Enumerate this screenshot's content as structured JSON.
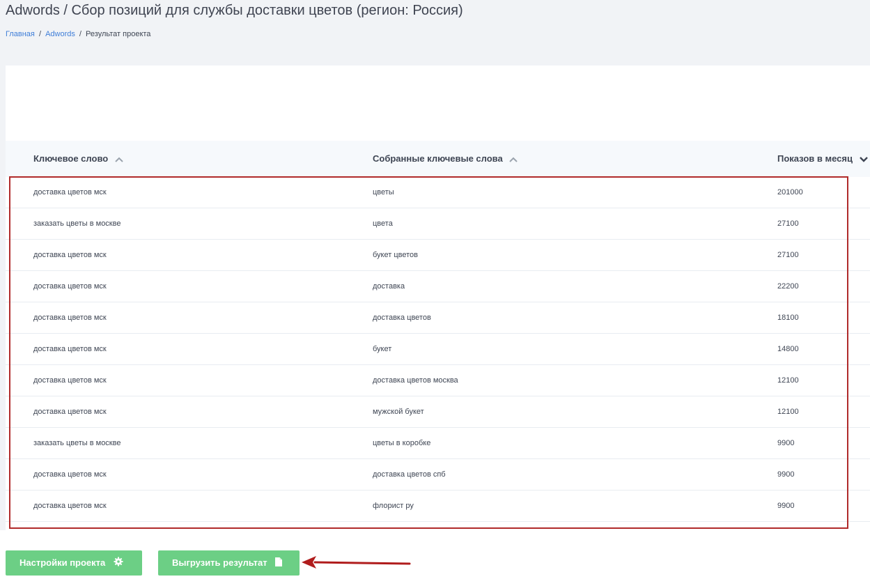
{
  "header": {
    "title": "Adwords / Сбор позиций для службы доставки цветов (регион: Россия)"
  },
  "breadcrumb": {
    "home": "Главная",
    "sep1": "/",
    "section": "Adwords",
    "sep2": "/",
    "current": "Результат проекта"
  },
  "table": {
    "columns": {
      "keyword": "Ключевое слово",
      "collected": "Собранные ключевые слова",
      "impressions": "Показов в месяц"
    },
    "rows": [
      {
        "keyword": "доставка цветов мск",
        "collected": "цветы",
        "impressions": "201000"
      },
      {
        "keyword": "заказать цветы в москве",
        "collected": "цвета",
        "impressions": "27100"
      },
      {
        "keyword": "доставка цветов мск",
        "collected": "букет цветов",
        "impressions": "27100"
      },
      {
        "keyword": "доставка цветов мск",
        "collected": "доставка",
        "impressions": "22200"
      },
      {
        "keyword": "доставка цветов мск",
        "collected": "доставка цветов",
        "impressions": "18100"
      },
      {
        "keyword": "доставка цветов мск",
        "collected": "букет",
        "impressions": "14800"
      },
      {
        "keyword": "доставка цветов мск",
        "collected": "доставка цветов москва",
        "impressions": "12100"
      },
      {
        "keyword": "доставка цветов мск",
        "collected": "мужской букет",
        "impressions": "12100"
      },
      {
        "keyword": "заказать цветы в москве",
        "collected": "цветы в коробке",
        "impressions": "9900"
      },
      {
        "keyword": "доставка цветов мск",
        "collected": "доставка цветов спб",
        "impressions": "9900"
      },
      {
        "keyword": "доставка цветов мск",
        "collected": "флорист ру",
        "impressions": "9900"
      }
    ]
  },
  "footer": {
    "settings_label": "Настройки проекта",
    "export_label": "Выгрузить результат"
  },
  "icons": {
    "sort_asc": "chevron-up-icon",
    "sort_desc": "chevron-down-icon",
    "settings": "gear-icon",
    "export": "document-icon",
    "annotation": "arrow-left-icon"
  },
  "colors": {
    "button": "#6ccf85",
    "link": "#3f7ed8",
    "highlight": "#b02a2a"
  }
}
